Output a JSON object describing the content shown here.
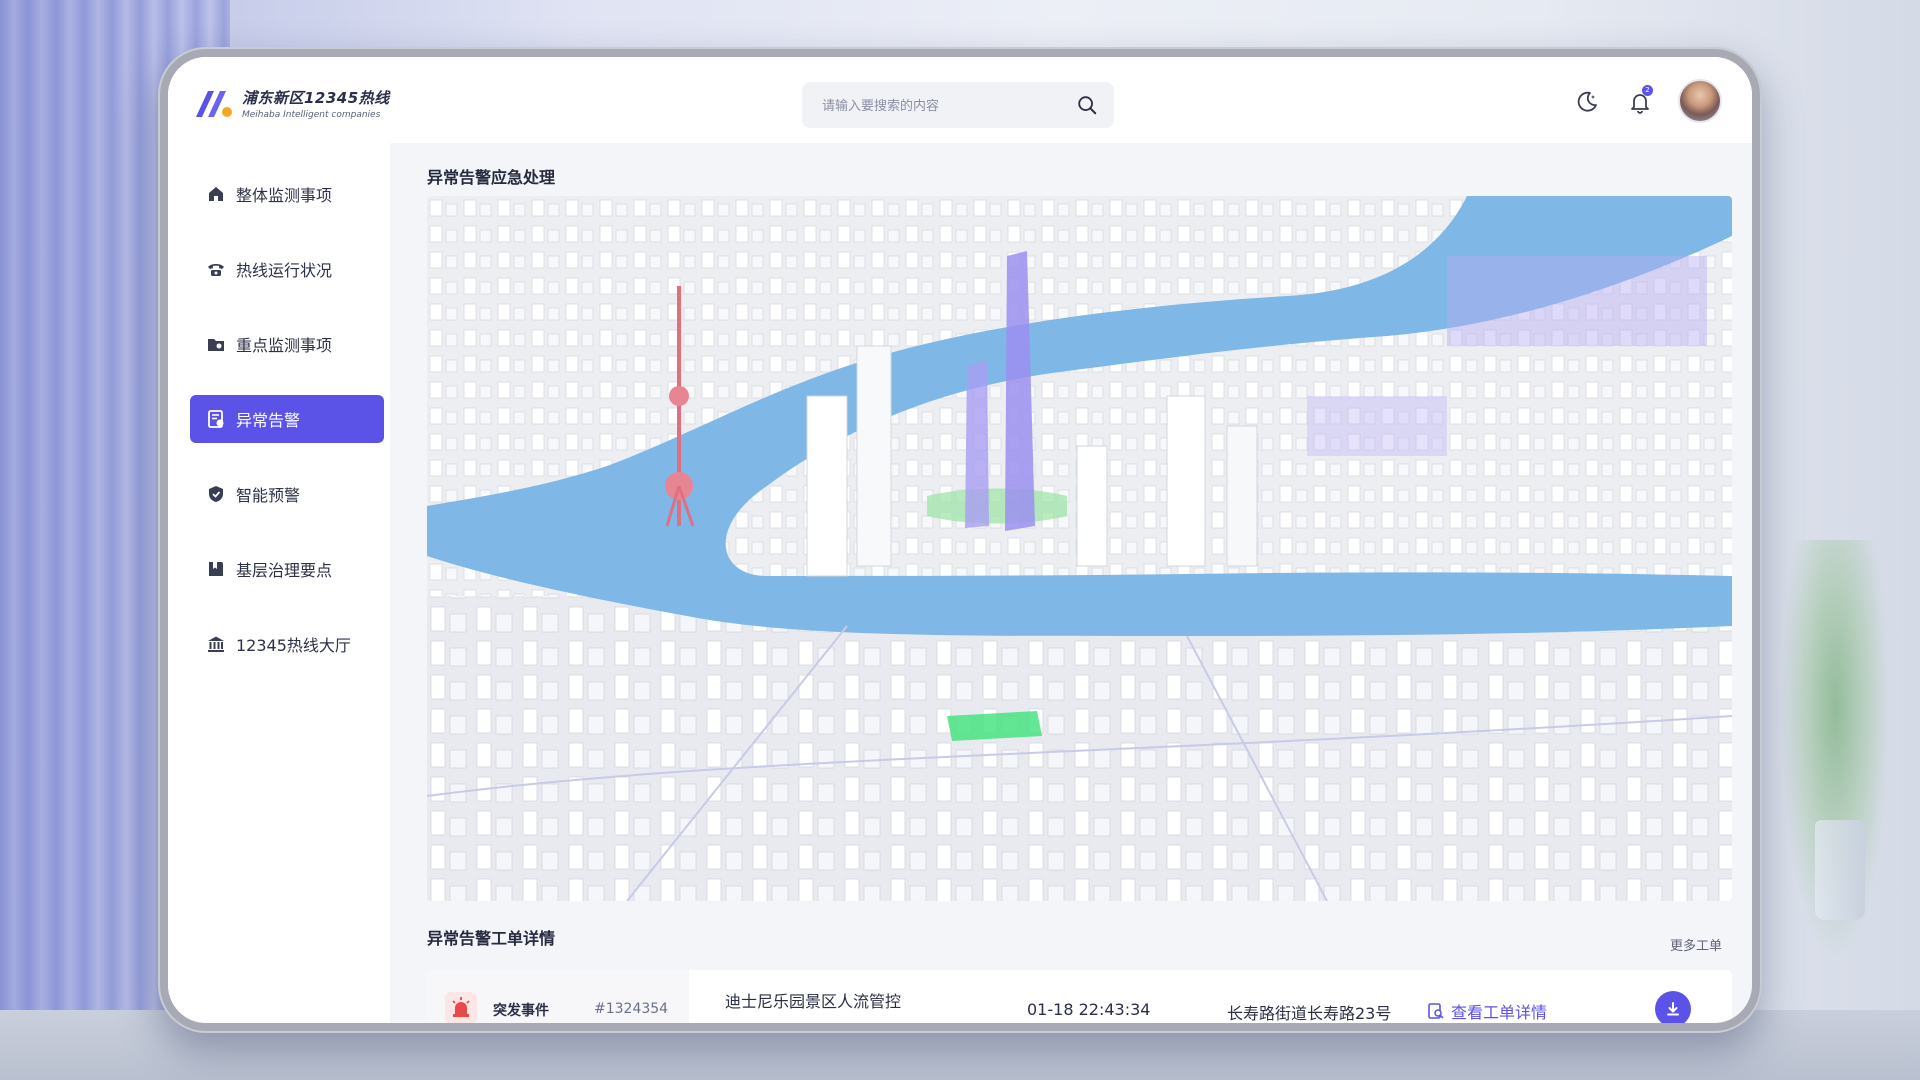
{
  "app": {
    "title": "浦东新区12345热线",
    "subtitle": "Meihaba Intelligent companies"
  },
  "search": {
    "placeholder": "请输入要搜索的内容"
  },
  "notifications": {
    "badge": "2"
  },
  "sidebar": {
    "items": [
      {
        "label": "整体监测事项",
        "icon": "home-icon",
        "active": false
      },
      {
        "label": "热线运行状况",
        "icon": "phone-icon",
        "active": false
      },
      {
        "label": "重点监测事项",
        "icon": "folder-icon",
        "active": false
      },
      {
        "label": "异常告警",
        "icon": "alert-document-icon",
        "active": true
      },
      {
        "label": "智能预警",
        "icon": "shield-icon",
        "active": false
      },
      {
        "label": "基层治理要点",
        "icon": "book-icon",
        "active": false
      },
      {
        "label": "12345热线大厅",
        "icon": "bank-icon",
        "active": false
      }
    ]
  },
  "main": {
    "map_title": "异常告警应急处理",
    "orders_title": "异常告警工单详情",
    "more_link": "更多工单",
    "orders": [
      {
        "type": "突发事件",
        "id": "#1324354",
        "title": "迪士尼乐园景区人流管控",
        "time": "01-18 22:43:34",
        "address": "长寿路街道长寿路23号",
        "detail_label": "查看工单详情"
      }
    ]
  },
  "colors": {
    "accent": "#5b52e8",
    "river": "#7fb7e6",
    "alert_bg": "#fde6e6",
    "alert_icon": "#e84a4a"
  }
}
